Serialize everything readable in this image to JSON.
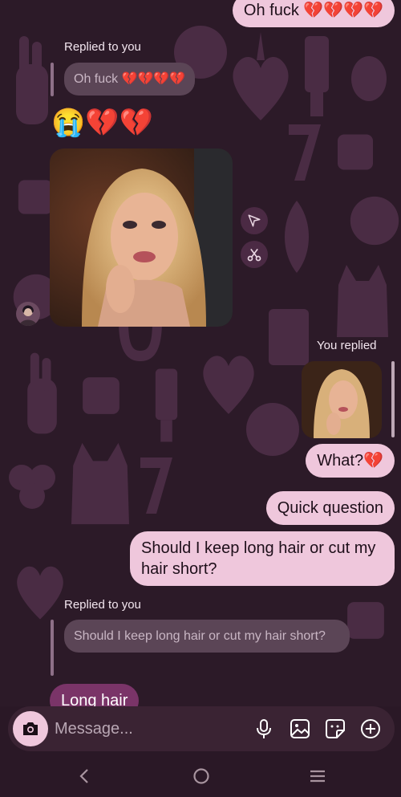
{
  "messages": {
    "m1_text": "Oh fuck 💔💔💔💔",
    "reply1_label": "Replied to you",
    "reply1_quote": "Oh fuck 💔💔💔💔",
    "emoji_line": "😭💔💔",
    "you_replied_label": "You replied",
    "m2_text": "What?💔",
    "m3_text": "Quick question",
    "m4_text": "Should I keep long hair or cut my hair short?",
    "reply2_label": "Replied to you",
    "reply2_quote": "Should I keep long hair or cut my hair short?",
    "m5_text": "Long hair"
  },
  "composer": {
    "placeholder": "Message..."
  },
  "colors": {
    "outgoing_bubble": "#efc7dc",
    "incoming_bubble": "#7a3468",
    "background": "#2c1a28"
  },
  "icons": {
    "camera": "camera-icon",
    "mic": "microphone-icon",
    "gallery": "gallery-icon",
    "sticker": "sticker-icon",
    "add": "plus-circle-icon",
    "share": "share-icon",
    "remix": "scissors-sparkle-icon",
    "back": "chevron-left-icon",
    "home": "home-circle-icon",
    "menu": "menu-lines-icon"
  }
}
